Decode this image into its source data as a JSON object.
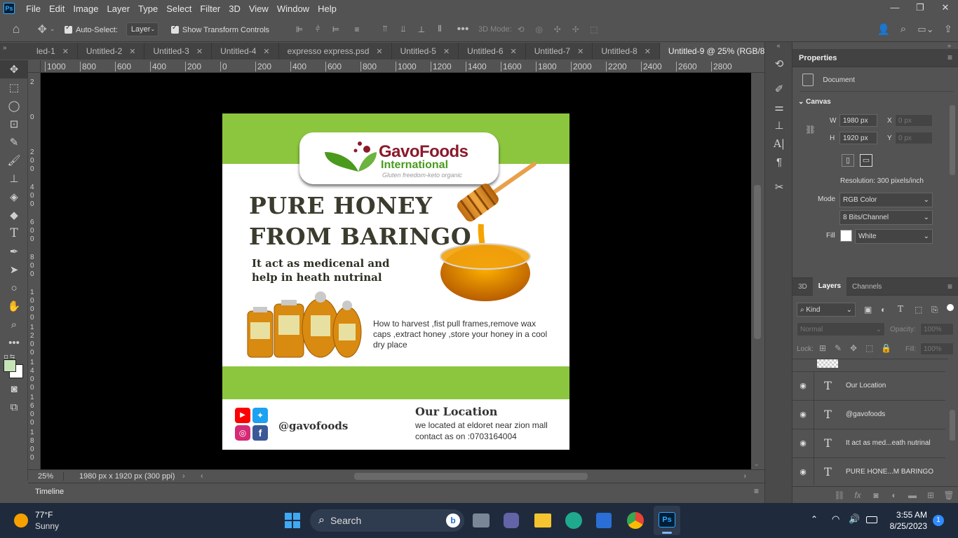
{
  "app": {
    "logo": "Ps",
    "accent": "#31a8ff"
  },
  "menu": [
    "File",
    "Edit",
    "Image",
    "Layer",
    "Type",
    "Select",
    "Filter",
    "3D",
    "View",
    "Window",
    "Help"
  ],
  "window_controls": {
    "minimize": "—",
    "restore": "❐",
    "close": "✕"
  },
  "options": {
    "auto_select_label": "Auto-Select:",
    "auto_select_value": "Layer",
    "show_transform_label": "Show Transform Controls",
    "mode_3d": "3D Mode:"
  },
  "tabs": [
    "led-1",
    "Untitled-2",
    "Untitled-3",
    "Untitled-4",
    "expresso express.psd",
    "Untitled-5",
    "Untitled-6",
    "Untitled-7",
    "Untitled-8",
    "Untitled-9 @ 25% (RGB/8#) *"
  ],
  "ruler_h": [
    "1000",
    "800",
    "600",
    "400",
    "200",
    "0",
    "200",
    "400",
    "600",
    "800",
    "1000",
    "1200",
    "1400",
    "1600",
    "1800",
    "2000",
    "2200",
    "2400",
    "2600",
    "2800"
  ],
  "ruler_v": [
    "2",
    "0",
    "2\n0\n0",
    "4\n0\n0",
    "6\n0\n0",
    "8\n0\n0",
    "1\n0\n0\n0",
    "1\n2\n0\n0",
    "1\n4\n0\n0",
    "1\n6\n0\n0",
    "1\n8\n0\n0"
  ],
  "status": {
    "zoom": "25%",
    "doc_info": "1980 px x 1920 px (300 ppi)"
  },
  "timeline_label": "Timeline",
  "properties": {
    "title": "Properties",
    "doc_label": "Document",
    "canvas_label": "Canvas",
    "w_label": "W",
    "w_value": "1980 px",
    "h_label": "H",
    "h_value": "1920 px",
    "x_label": "X",
    "x_value": "0 px",
    "y_label": "Y",
    "y_value": "0 px",
    "resolution": "Resolution: 300 pixels/inch",
    "mode_label": "Mode",
    "mode_value": "RGB Color",
    "bits_value": "8 Bits/Channel",
    "fill_label": "Fill",
    "fill_value": "White"
  },
  "layers_panel": {
    "tabs": [
      "3D",
      "Layers",
      "Channels"
    ],
    "kind": "Kind",
    "blend": "Normal",
    "opacity_label": "Opacity:",
    "opacity_value": "100%",
    "lock_label": "Lock:",
    "fill_label": "Fill:",
    "fill_value": "100%",
    "layers": [
      "Our Location",
      "@gavofoods",
      "It act as med...eath nutrinal",
      "PURE HONE...M BARINGO"
    ]
  },
  "artwork": {
    "brand_main": "GavoFoods",
    "brand_sub": "International",
    "tagline": "Gluten freedom-keto organic",
    "headline1": "PURE HONEY",
    "headline2": "FROM BARINGO",
    "sub1": "It act as medicenal and",
    "sub2": "help in heath nutrinal",
    "howto": "How to harvest ,fist pull frames,remove wax caps ,extract honey ,store your honey in a cool dry place",
    "handle": "@gavofoods",
    "loc_title": "Our Location",
    "loc1": "we located at eldoret near zion mall",
    "loc2": "contact as on :0703164004",
    "green": "#8cc63f",
    "brand_red": "#8b1a2b",
    "brand_green": "#4a9a1e",
    "headline_color": "#3b3b2e"
  },
  "taskbar": {
    "temp": "77°F",
    "weather": "Sunny",
    "search": "Search",
    "time": "3:55 AM",
    "date": "8/25/2023",
    "badge": "1"
  }
}
